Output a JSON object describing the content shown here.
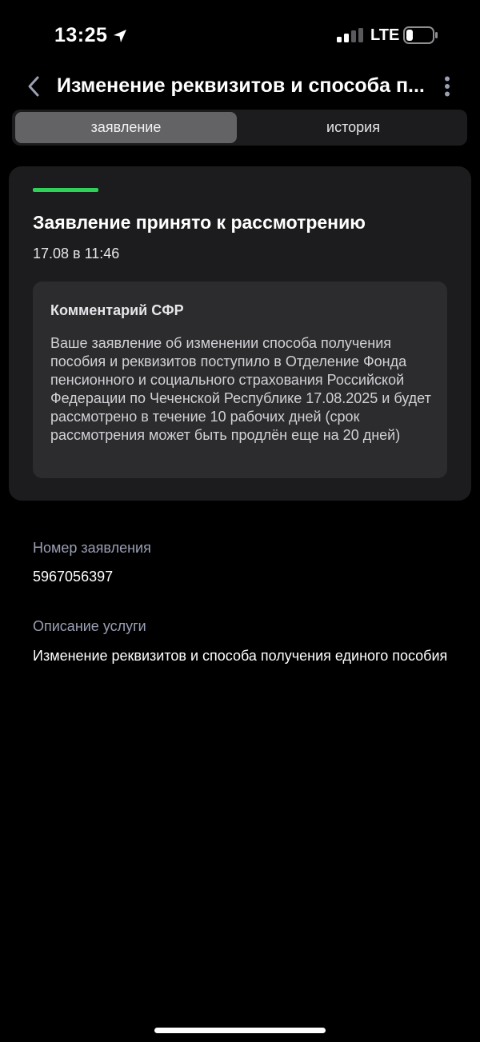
{
  "status_bar": {
    "time": "13:25",
    "network": "LTE",
    "icons": [
      "location-arrow-icon",
      "signal-icon",
      "battery-icon"
    ]
  },
  "header": {
    "title": "Изменение реквизитов и способа п...",
    "icons": [
      "chevron-left-icon",
      "more-vertical-icon"
    ]
  },
  "tabs": [
    {
      "label": "заявление",
      "active": true
    },
    {
      "label": "история",
      "active": false
    }
  ],
  "status_card": {
    "title": "Заявление принято к рассмотрению",
    "date": "17.08 в 11:46",
    "indicator_color": "#30d158",
    "comment": {
      "title": "Комментарий СФР",
      "text": "Ваше заявление об изменении способа получения пособия и реквизитов поступило в Отделение Фонда пенсионного и социального страхования Российской Федерации по Чеченской Республике 17.08.2025 и будет рассмотрено в течение 10 рабочих дней (срок рассмотрения может быть продлён еще на 20 дней)"
    }
  },
  "details": {
    "application_number_label": "Номер заявления",
    "application_number": "5967056397",
    "service_description_label": "Описание услуги",
    "service_description": "Изменение реквизитов и способа получения единого пособия"
  },
  "colors": {
    "background": "#000000",
    "card": "#1c1c1e",
    "comment_box": "#2c2c2e",
    "accent_green": "#30d158",
    "label_gray": "#9a9fb3"
  }
}
